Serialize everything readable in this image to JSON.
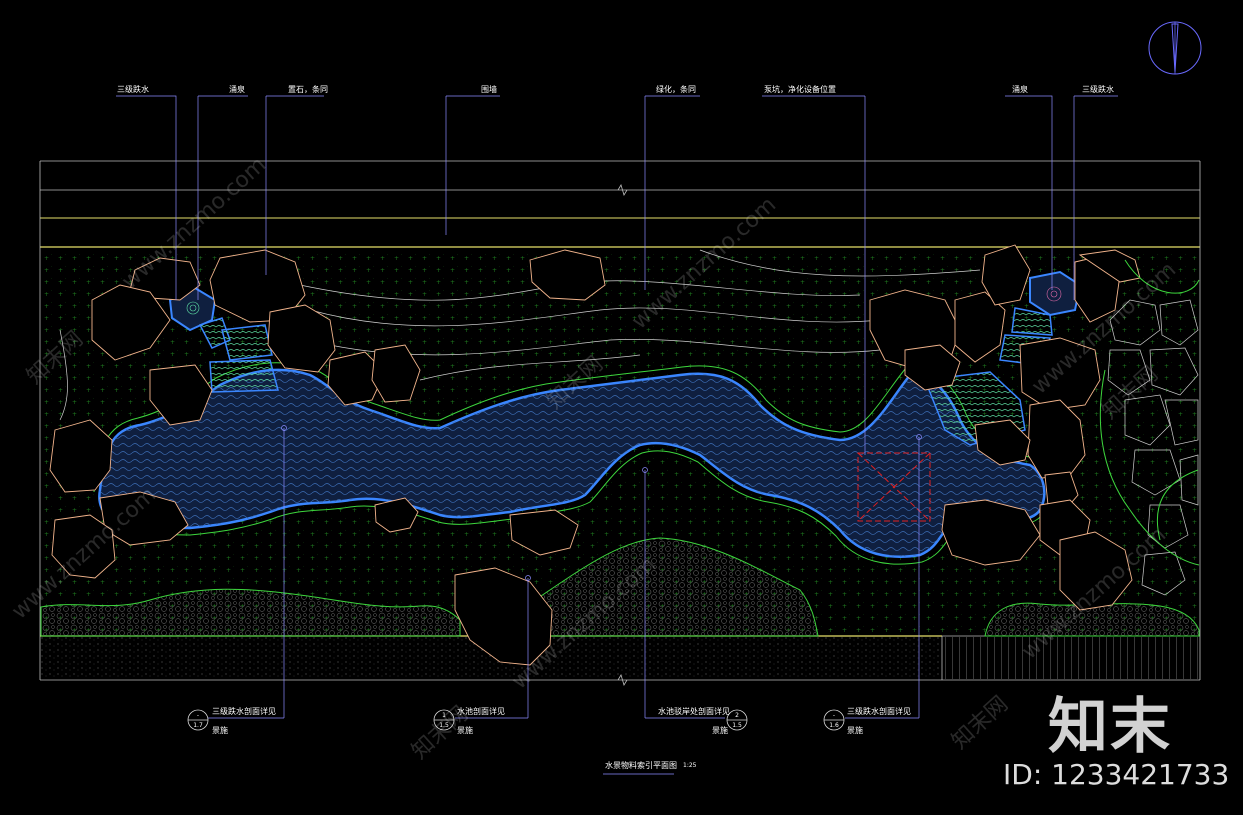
{
  "callouts_top": [
    {
      "id": "cascade-left",
      "text": "三级跌水"
    },
    {
      "id": "spring-left",
      "text": "涌泉"
    },
    {
      "id": "stone-left",
      "text": "置石，条同"
    },
    {
      "id": "wall",
      "text": "围墙"
    },
    {
      "id": "green",
      "text": "绿化，条同"
    },
    {
      "id": "pump",
      "text": "泵坑，净化设备位置"
    },
    {
      "id": "spring-right",
      "text": "涌泉"
    },
    {
      "id": "cascade-right",
      "text": "三级跌水"
    }
  ],
  "callouts_bottom": [
    {
      "id": "b1",
      "text": "三级跌水剖面详见",
      "num": "-",
      "sheet": "1.7",
      "sub": "景施"
    },
    {
      "id": "b2",
      "text": "水池剖面详见",
      "num": "1",
      "sheet": "1.5",
      "sub": "景施"
    },
    {
      "id": "b3",
      "text": "水池驳岸处剖面详见",
      "num": "2",
      "sheet": "1.5",
      "sub": "景施"
    },
    {
      "id": "b4",
      "text": "三级跌水剖面详见",
      "num": "-",
      "sheet": "1.6",
      "sub": "景施"
    }
  ],
  "title": {
    "text": "水景物料索引平面图",
    "scale": "1:25"
  },
  "watermark": {
    "site": "www.znzmo.com",
    "brand": "知末网",
    "logo": "知末",
    "id": "ID: 1233421733"
  },
  "colors": {
    "water": "#0f1f3f",
    "water_edge": "#3a86ff",
    "grass_edge": "#3dd63d",
    "rock": "#f2b48c",
    "wall": "#e6e06a",
    "leader": "#8c8cff",
    "hatch": "#1e7a1e",
    "red": "#e02020"
  }
}
